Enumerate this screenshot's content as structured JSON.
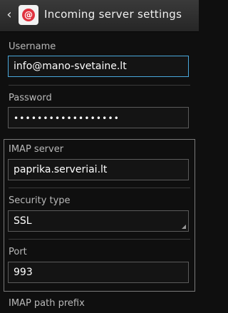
{
  "header": {
    "title": "Incoming server settings",
    "back_icon": "back-chevron-icon",
    "app_icon": "email-app-icon"
  },
  "username": {
    "label": "Username",
    "value": "info@mano-svetaine.lt"
  },
  "password": {
    "label": "Password",
    "value": "••••••••••••••••••"
  },
  "imap_server": {
    "label": "IMAP server",
    "value": "paprika.serveriai.lt"
  },
  "security_type": {
    "label": "Security type",
    "value": "SSL"
  },
  "port": {
    "label": "Port",
    "value": "993"
  },
  "imap_path_prefix": {
    "label": "IMAP path prefix"
  },
  "colors": {
    "focus_border": "#4aa8dc",
    "background": "#0f0f0f"
  }
}
